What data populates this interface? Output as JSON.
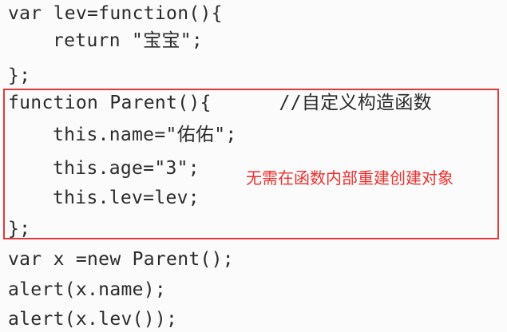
{
  "code": {
    "lines": [
      "var lev=function(){",
      "return \"宝宝\";",
      "};",
      "function Parent(){      //自定义构造函数",
      "this.name=\"佑佑\";",
      "this.age=\"3\";",
      "this.lev=lev;",
      "};",
      "var x =new Parent();",
      "alert(x.name);",
      "alert(x.lev());"
    ]
  },
  "annotation": {
    "text": "无需在函数内部重建创建对象",
    "color": "#e8322e"
  },
  "highlight": {
    "border_color": "#e03a3a"
  }
}
